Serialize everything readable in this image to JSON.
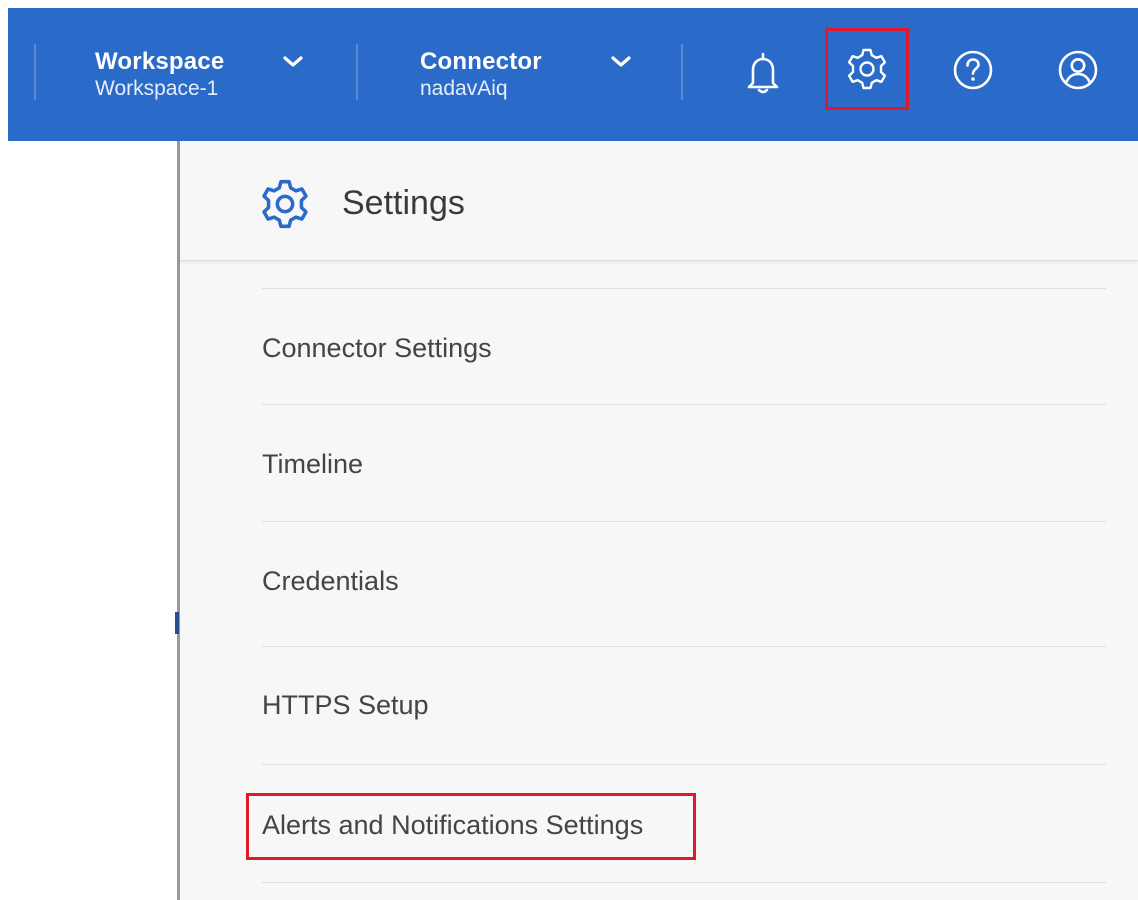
{
  "header": {
    "workspace": {
      "title": "Workspace",
      "value": "Workspace-1"
    },
    "connector": {
      "title": "Connector",
      "value": "nadavAiq"
    },
    "icons": [
      "chevron-down-icon",
      "bell-icon",
      "gear-icon",
      "help-icon",
      "user-icon"
    ],
    "accent_color": "#2a6ac8",
    "highlight_color": "#e0182c"
  },
  "settings_panel": {
    "title": "Settings",
    "items": [
      {
        "label": "Connector Settings"
      },
      {
        "label": "Timeline"
      },
      {
        "label": "Credentials"
      },
      {
        "label": "HTTPS Setup"
      },
      {
        "label": "Alerts and Notifications Settings",
        "highlighted": true
      }
    ]
  }
}
